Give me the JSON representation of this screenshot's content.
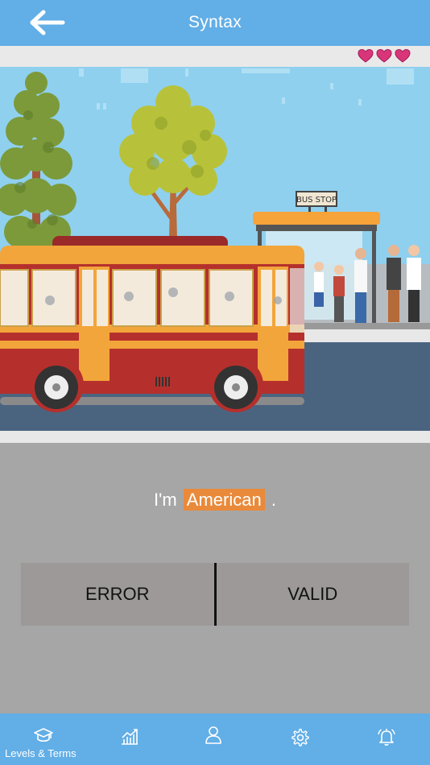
{
  "header": {
    "title": "Syntax"
  },
  "lives": {
    "count": 3,
    "color": "#d9367a"
  },
  "exercise": {
    "sentence_before": "I'm",
    "highlight_word": "American",
    "sentence_after": ".",
    "highlight_color": "#e9893a",
    "scene_sign": "BUS STOP"
  },
  "choices": {
    "error_label": "ERROR",
    "valid_label": "VALID"
  },
  "tabbar": {
    "active_label": "Levels & Terms",
    "icons": [
      "graduation-cap-icon",
      "chart-icon",
      "user-icon",
      "gear-icon",
      "bell-icon"
    ]
  },
  "colors": {
    "header": "#62aee6",
    "background": "#a6a6a6",
    "choice": "#9d9999"
  }
}
